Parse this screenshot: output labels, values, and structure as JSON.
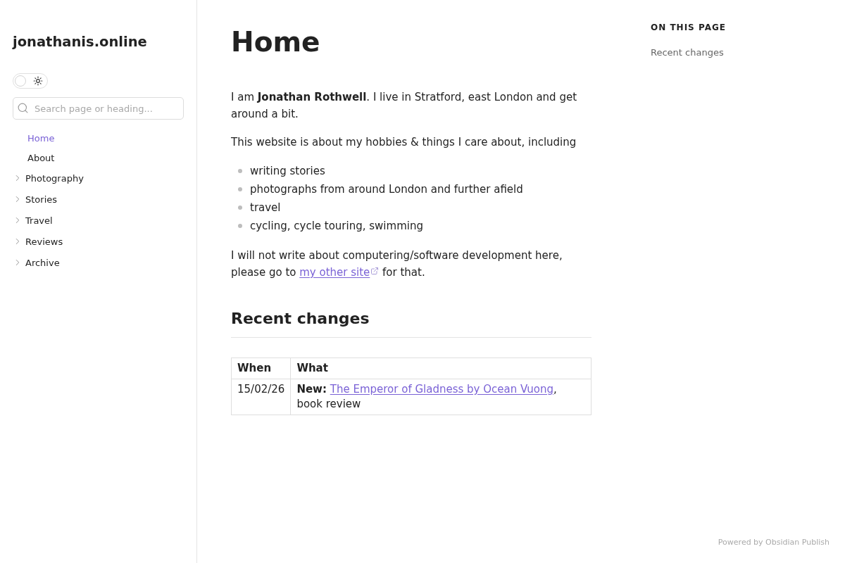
{
  "sidebar": {
    "site_title": "jonathanis.online",
    "theme_toggle": {
      "dark_mode": false
    },
    "search": {
      "placeholder": "Search page or heading..."
    },
    "nav": [
      {
        "kind": "page",
        "label": "Home",
        "selected": true
      },
      {
        "kind": "page",
        "label": "About",
        "selected": false
      },
      {
        "kind": "folder",
        "label": "Photography",
        "selected": false,
        "expanded": false
      },
      {
        "kind": "folder",
        "label": "Stories",
        "selected": false,
        "expanded": false
      },
      {
        "kind": "folder",
        "label": "Travel",
        "selected": false,
        "expanded": false
      },
      {
        "kind": "folder",
        "label": "Reviews",
        "selected": false,
        "expanded": false
      },
      {
        "kind": "folder",
        "label": "Archive",
        "selected": false,
        "expanded": false
      }
    ]
  },
  "page": {
    "title": "Home",
    "blocks": [
      {
        "kind": "paragraph",
        "text": "I am **Jonathan Rothwell**. I live in Stratford, east London and get around a bit."
      },
      {
        "kind": "paragraph",
        "text": "This website is about my hobbies & things I care about, including"
      },
      {
        "kind": "list",
        "items": [
          "writing stories",
          "photographs from around London and further afield",
          "travel",
          "cycling, cycle touring, swimming"
        ]
      },
      {
        "kind": "link_paragraph",
        "before": "I will not write about computering/software development here, please go to ",
        "link": "my other site",
        "after": " for that."
      }
    ],
    "section_heading": "Recent changes",
    "table": {
      "columns": [
        "When",
        "What"
      ],
      "rows": [
        {
          "when": "15/02/26",
          "what": {
            "label": "New:",
            "link": "The Emperor of Gladness by Ocean Vuong",
            "after": ", book review"
          }
        }
      ]
    }
  },
  "outline": {
    "heading": "ON THIS PAGE",
    "items": [
      "Recent changes"
    ]
  },
  "footer": {
    "text": "Powered by Obsidian Publish"
  }
}
